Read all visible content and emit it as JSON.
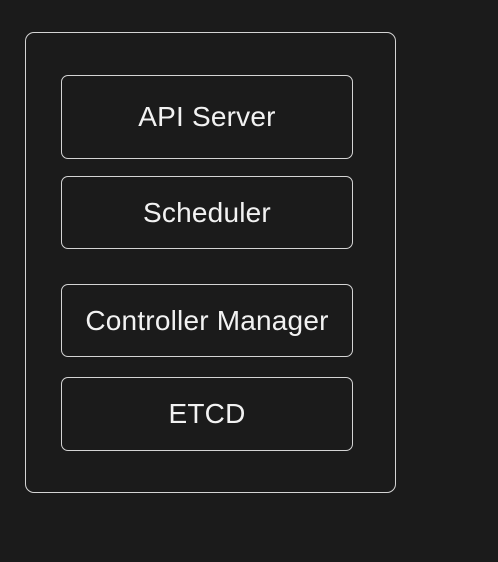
{
  "diagram": {
    "components": [
      {
        "label": "API Server"
      },
      {
        "label": "Scheduler"
      },
      {
        "label": "Controller Manager"
      },
      {
        "label": "ETCD"
      }
    ]
  }
}
